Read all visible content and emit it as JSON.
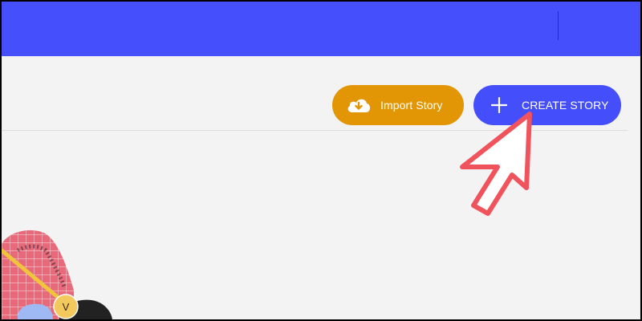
{
  "header": {
    "bar_color": "#464ffc"
  },
  "toolbar": {
    "import_button": {
      "label": "Import Story",
      "icon": "cloud-download-icon",
      "color": "#e29606"
    },
    "create_button": {
      "label": "CREATE STORY",
      "icon": "plus-icon",
      "color": "#444efa"
    }
  },
  "annotation": {
    "icon": "pointer-arrow-icon",
    "color": "#f0535c"
  },
  "illustration": {
    "avatar_initial": "V"
  }
}
